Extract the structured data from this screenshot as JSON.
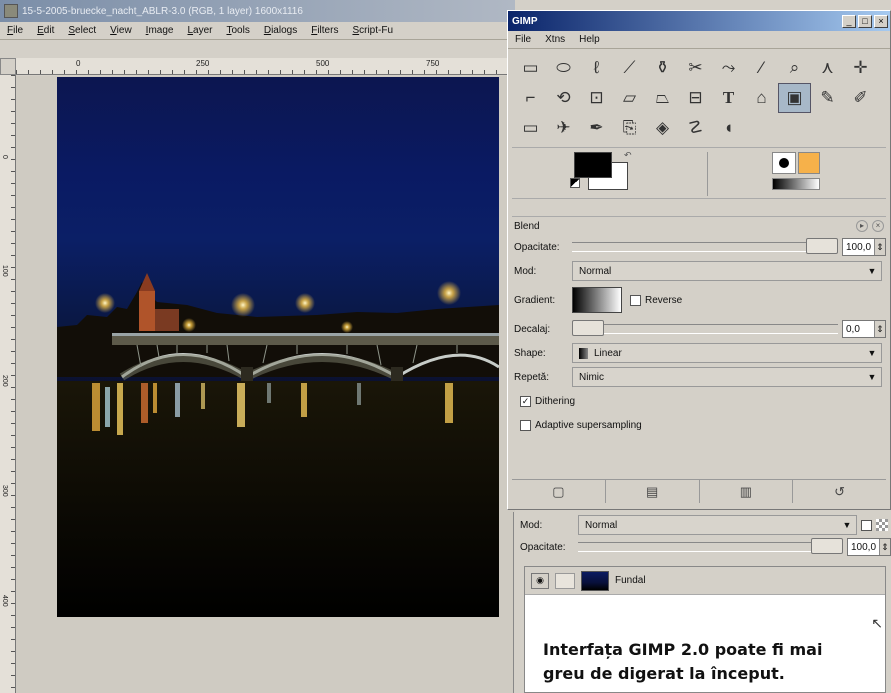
{
  "image_window": {
    "title": "15-5-2005-bruecke_nacht_ABLR-3.0 (RGB, 1 layer) 1600x1116",
    "menu": [
      "File",
      "Edit",
      "Select",
      "View",
      "Image",
      "Layer",
      "Tools",
      "Dialogs",
      "Filters",
      "Script-Fu"
    ],
    "hruler_labels": [
      "0",
      "250",
      "500",
      "750"
    ],
    "vruler_labels": [
      "0",
      "100",
      "200",
      "300",
      "400",
      "500"
    ]
  },
  "toolbox": {
    "title": "GIMP",
    "menu": [
      "File",
      "Xtns",
      "Help"
    ],
    "window_buttons": [
      "_",
      "□",
      "×"
    ],
    "tools": [
      {
        "icon": "rect-select-icon",
        "glyph": "▭"
      },
      {
        "icon": "ellipse-select-icon",
        "glyph": "⬭"
      },
      {
        "icon": "lasso-icon",
        "glyph": "ℓ"
      },
      {
        "icon": "fuzzy-select-icon",
        "glyph": "⟋"
      },
      {
        "icon": "color-select-icon",
        "glyph": "⚱"
      },
      {
        "icon": "scissors-icon",
        "glyph": "✂"
      },
      {
        "icon": "paths-icon",
        "glyph": "⤳"
      },
      {
        "icon": "color-picker-icon",
        "glyph": "⁄"
      },
      {
        "icon": "zoom-icon",
        "glyph": "⌕"
      },
      {
        "icon": "measure-icon",
        "glyph": "⋏"
      },
      {
        "icon": "move-icon",
        "glyph": "✛"
      },
      {
        "icon": "crop-icon",
        "glyph": "⌐"
      },
      {
        "icon": "rotate-icon",
        "glyph": "⟲"
      },
      {
        "icon": "scale-icon",
        "glyph": "⊡"
      },
      {
        "icon": "shear-icon",
        "glyph": "⏥"
      },
      {
        "icon": "perspective-icon",
        "glyph": "⏢"
      },
      {
        "icon": "flip-icon",
        "glyph": "⊟"
      },
      {
        "icon": "text-icon",
        "glyph": "T"
      },
      {
        "icon": "bucket-fill-icon",
        "glyph": "⌂"
      },
      {
        "icon": "blend-icon",
        "glyph": "▣"
      },
      {
        "icon": "pencil-icon",
        "glyph": "✎"
      },
      {
        "icon": "paintbrush-icon",
        "glyph": "✐"
      },
      {
        "icon": "eraser-icon",
        "glyph": "▭"
      },
      {
        "icon": "airbrush-icon",
        "glyph": "✈"
      },
      {
        "icon": "ink-icon",
        "glyph": "✒"
      },
      {
        "icon": "clone-icon",
        "glyph": "⎘"
      },
      {
        "icon": "convolve-icon",
        "glyph": "◈"
      },
      {
        "icon": "smudge-icon",
        "glyph": "☡"
      },
      {
        "icon": "dodge-burn-icon",
        "glyph": "◖"
      }
    ],
    "active_tool_index": 19,
    "tool_options": {
      "title": "Blend",
      "opacity_label": "Opacitate:",
      "opacity_value": "100,0",
      "opacity_fraction": 1.0,
      "mode_label": "Mod:",
      "mode_value": "Normal",
      "gradient_label": "Gradient:",
      "reverse_label": "Reverse",
      "reverse_checked": false,
      "offset_label": "Decalaj:",
      "offset_value": "0,0",
      "offset_fraction": 0.0,
      "shape_label": "Shape:",
      "shape_value": "Linear",
      "repeat_label": "Repetă:",
      "repeat_value": "Nimic",
      "dithering_label": "Dithering",
      "dithering_checked": true,
      "adaptive_label": "Adaptive supersampling",
      "adaptive_checked": false
    },
    "bottom_buttons": [
      "save-options-icon",
      "restore-options-icon",
      "delete-options-icon",
      "reset-options-icon"
    ]
  },
  "layers": {
    "mode_label": "Mod:",
    "mode_value": "Normal",
    "opacity_label": "Opacitate:",
    "opacity_value": "100,0",
    "layer_name": "Fundal"
  },
  "caption": "Interfața GIMP 2.0 poate fi mai greu de digerat la început.",
  "colors": {
    "titlebar_active": "#0a246a",
    "window_bg": "#d4d0c8",
    "foreground": "#000000",
    "background": "#ffffff"
  }
}
